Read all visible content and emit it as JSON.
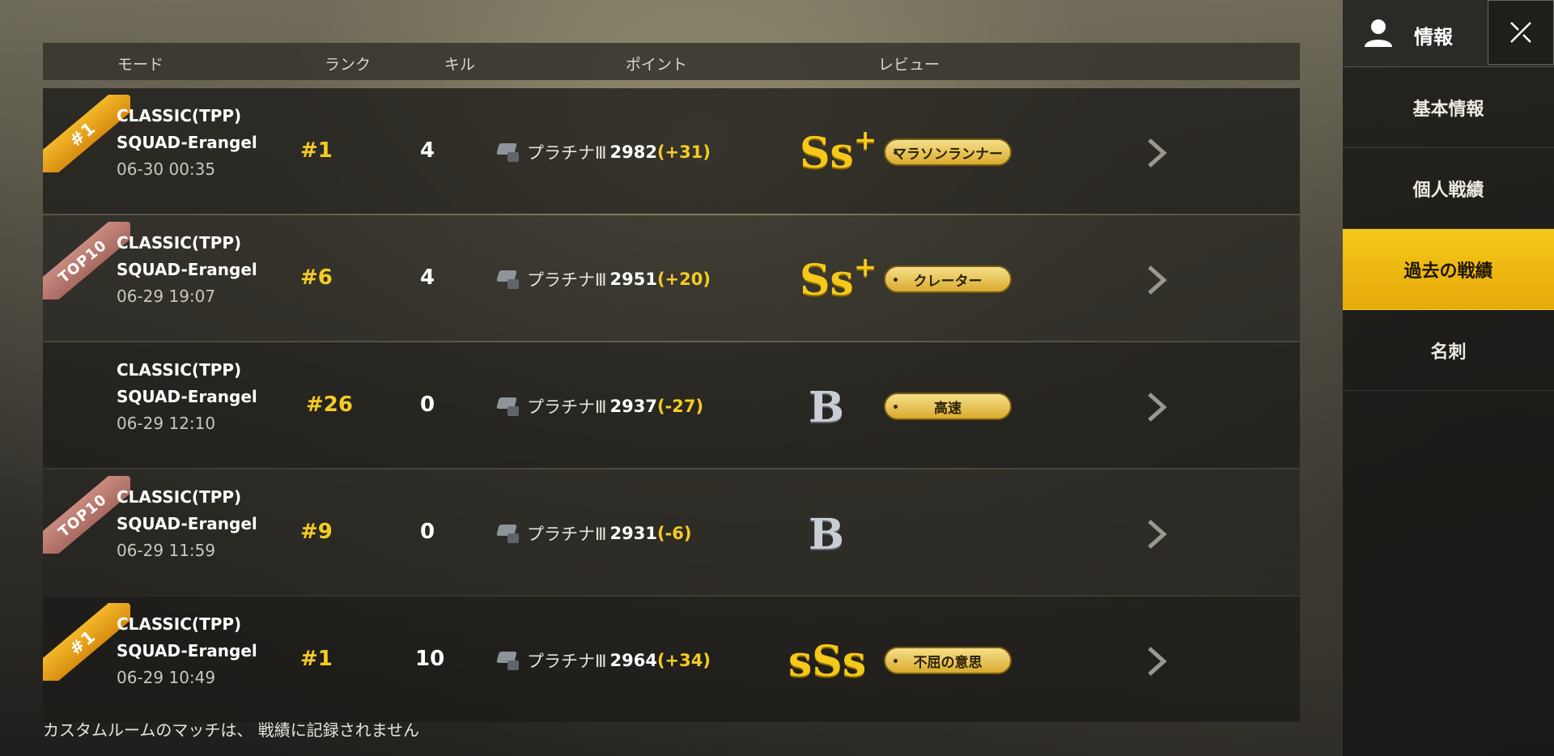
{
  "headers": {
    "mode": "モード",
    "rank": "ランク",
    "kill": "キル",
    "points": "ポイント",
    "review": "レビュー"
  },
  "rows": [
    {
      "ribbon": "#1",
      "mode": "CLASSIC(TPP)",
      "map": "SQUAD-Erangel",
      "date": "06-30 00:35",
      "rank": "#1",
      "kills": "4",
      "tier": "プラチナⅢ",
      "points": "2982",
      "delta": "(+31)",
      "grade": "Ss",
      "grade_plus": "+",
      "badge": "マラソンランナー"
    },
    {
      "ribbon": "TOP10",
      "mode": "CLASSIC(TPP)",
      "map": "SQUAD-Erangel",
      "date": "06-29 19:07",
      "rank": "#6",
      "kills": "4",
      "tier": "プラチナⅢ",
      "points": "2951",
      "delta": "(+20)",
      "grade": "Ss",
      "grade_plus": "+",
      "badge": "クレーター"
    },
    {
      "ribbon": "",
      "mode": "CLASSIC(TPP)",
      "map": "SQUAD-Erangel",
      "date": "06-29 12:10",
      "rank": "#26",
      "kills": "0",
      "tier": "プラチナⅢ",
      "points": "2937",
      "delta": "(-27)",
      "grade": "B",
      "grade_plus": "",
      "badge": "高速"
    },
    {
      "ribbon": "TOP10",
      "mode": "CLASSIC(TPP)",
      "map": "SQUAD-Erangel",
      "date": "06-29 11:59",
      "rank": "#9",
      "kills": "0",
      "tier": "プラチナⅢ",
      "points": "2931",
      "delta": "(-6)",
      "grade": "B",
      "grade_plus": "",
      "badge": ""
    },
    {
      "ribbon": "#1",
      "mode": "CLASSIC(TPP)",
      "map": "SQUAD-Erangel",
      "date": "06-29 10:49",
      "rank": "#1",
      "kills": "10",
      "tier": "プラチナⅢ",
      "points": "2964",
      "delta": "(+34)",
      "grade": "sSs",
      "grade_plus": "",
      "badge": "不屈の意思"
    }
  ],
  "footer": "カスタムルームのマッチは、 戦績に記録されません",
  "sidebar": {
    "title": "情報",
    "items": [
      {
        "label": "基本情報",
        "active": false
      },
      {
        "label": "個人戦績",
        "active": false
      },
      {
        "label": "過去の戦績",
        "active": true
      },
      {
        "label": "名刺",
        "active": false
      }
    ]
  },
  "colors": {
    "accent": "#F5C81A",
    "delta": "#F5CC22"
  }
}
